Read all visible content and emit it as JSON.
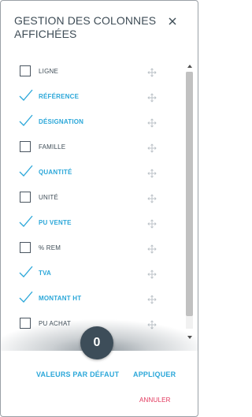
{
  "dialog": {
    "title": "GESTION DES COLONNES AFFICHÉES",
    "close_icon": "close-icon"
  },
  "columns": [
    {
      "label": "LIGNE",
      "checked": false
    },
    {
      "label": "RÉFÉRENCE",
      "checked": true
    },
    {
      "label": "DÉSIGNATION",
      "checked": true
    },
    {
      "label": "FAMILLE",
      "checked": false
    },
    {
      "label": "QUANTITÉ",
      "checked": true
    },
    {
      "label": "UNITÉ",
      "checked": false
    },
    {
      "label": "PU VENTE",
      "checked": true
    },
    {
      "label": "% REM",
      "checked": false
    },
    {
      "label": "TVA",
      "checked": true
    },
    {
      "label": "MONTANT HT",
      "checked": true
    },
    {
      "label": "PU ACHAT",
      "checked": false
    }
  ],
  "badge": {
    "count": "0"
  },
  "actions": {
    "defaults_label": "VALEURS PAR DÉFAUT",
    "apply_label": "APPLIQUER",
    "cancel_label": "ANNULER"
  },
  "colors": {
    "accent": "#2ba7d9",
    "text": "#3f4d57",
    "danger": "#e2365b",
    "badge": "#3d4d59"
  }
}
